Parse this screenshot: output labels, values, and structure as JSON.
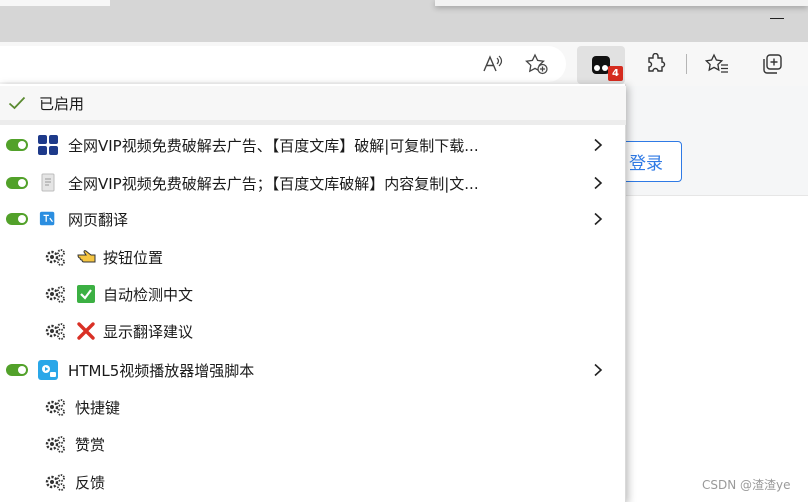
{
  "toolbar": {
    "extension_badge": "4"
  },
  "page": {
    "login_label": "登录",
    "watermark": "CSDN @渣渣ye"
  },
  "menu": {
    "enabled_label": "已启用",
    "scripts": [
      {
        "label": "全网VIP视频免费破解去广告、【百度文库】破解|可复制下载...",
        "enabled": true
      },
      {
        "label": "全网VIP视频免费破解去广告；【百度文库破解】内容复制|文...",
        "enabled": true
      },
      {
        "label": "网页翻译",
        "enabled": true,
        "commands": [
          "按钮位置",
          "自动检测中文",
          "显示翻译建议"
        ]
      },
      {
        "label": "HTML5视频播放器增强脚本",
        "enabled": true,
        "commands": [
          "快捷键",
          "赞赏",
          "反馈"
        ]
      }
    ]
  },
  "colors": {
    "toggle_on": "#52a12a",
    "badge": "#d52b1e",
    "link_blue": "#2f7ae5"
  }
}
